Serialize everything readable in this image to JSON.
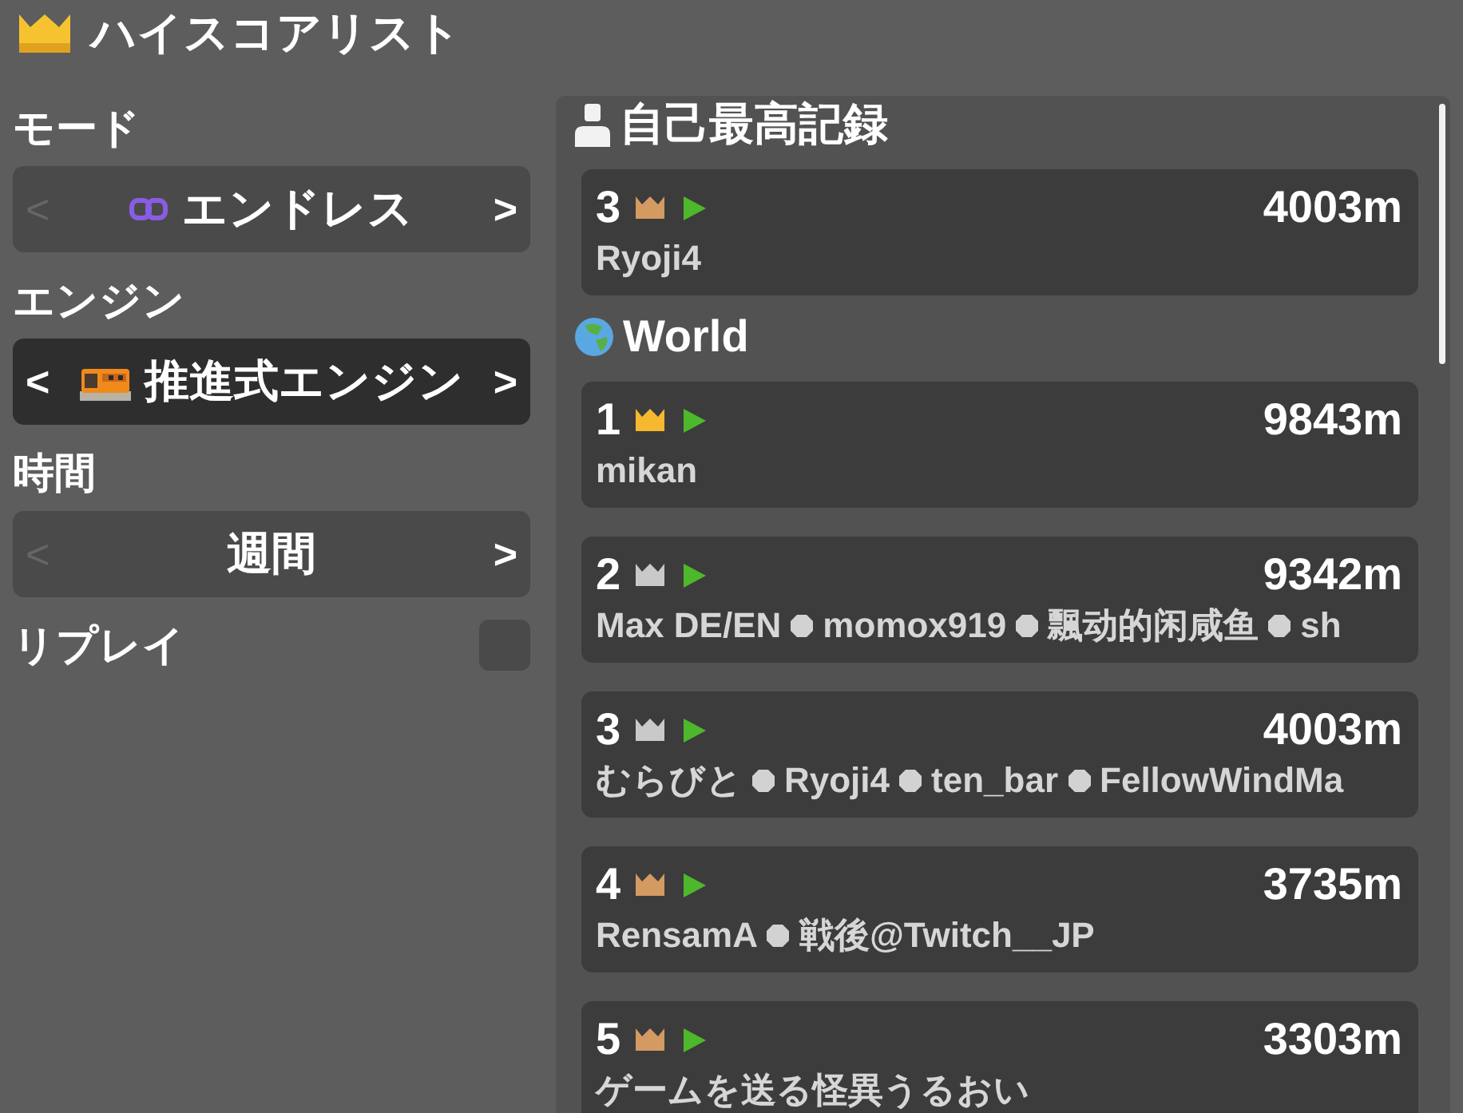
{
  "window": {
    "title": "ハイスコアリスト"
  },
  "settings": [
    {
      "kind": "heading",
      "label": "モード"
    },
    {
      "kind": "mode",
      "value": "エンドレス",
      "prev": {
        "label": "<",
        "disabled": true
      },
      "next": {
        "label": ">",
        "disabled": false
      },
      "focused": false
    },
    {
      "kind": "heading",
      "label": "エンジン"
    },
    {
      "kind": "engine",
      "value": "推進式エンジン",
      "prev": {
        "label": "<",
        "disabled": false
      },
      "next": {
        "label": ">",
        "disabled": false
      },
      "focused": true
    },
    {
      "kind": "heading",
      "label": "時間"
    },
    {
      "kind": "period",
      "value": "週間",
      "prev": {
        "label": "<",
        "disabled": true
      },
      "next": {
        "label": ">",
        "disabled": false
      },
      "focused": false
    },
    {
      "kind": "toggle",
      "label": "リプレイ",
      "checked": false
    }
  ],
  "sections": [
    {
      "kind": "personal",
      "title": "自己最高記録",
      "entries": [
        {
          "rank": "3",
          "color": "#d39a62",
          "distance": "4003m",
          "players": [
            "Ryoji4"
          ]
        }
      ]
    },
    {
      "kind": "world",
      "title": "World",
      "entries": [
        {
          "rank": "1",
          "color": "#f5b82e",
          "distance": "9843m",
          "players": [
            "mikan"
          ]
        },
        {
          "rank": "2",
          "color": "#c9c9c9",
          "distance": "9342m",
          "players": [
            "Max DE/EN",
            "momox919",
            "飄动的闲咸鱼",
            "sh"
          ]
        },
        {
          "rank": "3",
          "color": "#c9c9c9",
          "distance": "4003m",
          "players": [
            "むらびと",
            "Ryoji4",
            "ten_bar",
            "FellowWindMa"
          ]
        },
        {
          "rank": "4",
          "color": "#d39a62",
          "distance": "3735m",
          "players": [
            "RensamA",
            "戦後@Twitch__JP"
          ]
        },
        {
          "rank": "5",
          "color": "#d39a62",
          "distance": "3303m",
          "players": [
            "ゲームを送る怪異うるおい"
          ]
        }
      ]
    }
  ]
}
